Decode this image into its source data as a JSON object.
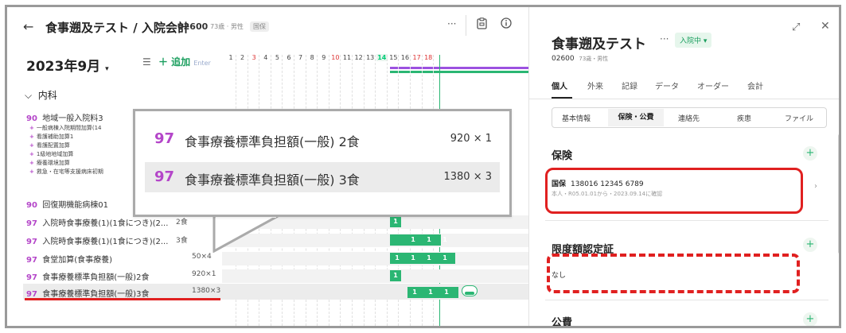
{
  "header": {
    "back_icon": "arrow-left-icon",
    "title": "食事遡及テスト / 入院会計",
    "patient_id": "02600",
    "patient_meta": "· 73歳 · 男性",
    "insurance_tag": "国保"
  },
  "toolbar": {
    "more": "···",
    "clipboard": "clipboard-icon",
    "info": "info-icon"
  },
  "calendar": {
    "month": "2023年9月",
    "add_label": "＋ 追加",
    "add_hint": "Enter",
    "days": [
      "1",
      "2",
      "3",
      "4",
      "5",
      "6",
      "7",
      "8",
      "9",
      "10",
      "11",
      "12",
      "13",
      "14",
      "15",
      "16",
      "17",
      "18"
    ],
    "red_days": [
      "3",
      "10",
      "17",
      "18"
    ],
    "today": "14"
  },
  "section": {
    "label": "内科"
  },
  "rows": [
    {
      "code": "90",
      "name": "地域一般入院料3",
      "count": ""
    },
    {
      "code": "90",
      "name": "回復期機能病棟01",
      "count": ""
    },
    {
      "code": "97",
      "name": "入院時食事療養(1)(1食につき)(2...",
      "count": "2食"
    },
    {
      "code": "97",
      "name": "入院時食事療養(1)(1食につき)(2...",
      "count": "3食"
    },
    {
      "code": "97",
      "name": "食堂加算(食事療養)",
      "count": "50×4"
    },
    {
      "code": "97",
      "name": "食事療養標準負担額(一般)2食",
      "count": "920×1"
    },
    {
      "code": "97",
      "name": "食事療養標準負担額(一般)3食",
      "count": "1380×3"
    }
  ],
  "subrows": [
    "一般病棟入院期間加算(14",
    "看護補助加算1",
    "看護配置加算",
    "1級地地域加算",
    "療養環境加算",
    "救急・在宅等支援病床初期"
  ],
  "cell_value": "1",
  "callout": {
    "lines": [
      {
        "code": "97",
        "name": "食事療養標準負担額(一般) 2食",
        "value": "920 × 1"
      },
      {
        "code": "97",
        "name": "食事療養標準負担額(一般) 3食",
        "value": "1380 × 3"
      }
    ]
  },
  "panel": {
    "name": "食事遡及テスト",
    "more": "···",
    "status": "入院中 ▾",
    "patient_id": "02600",
    "patient_meta": "73歳・男性",
    "tabs": [
      "個人",
      "外来",
      "記録",
      "データ",
      "オーダー",
      "会計"
    ],
    "segments": [
      "基本情報",
      "保険・公費",
      "連絡先",
      "疾患",
      "ファイル"
    ],
    "insurance_head": "保険",
    "insurance_type": "国保",
    "insurance_numbers": "138016   12345   6789",
    "insurance_sub": "本人・R05.01.01から・2023.09.14に確認",
    "limit_head": "限度額認定証",
    "limit_value": "なし",
    "public_head": "公費"
  }
}
